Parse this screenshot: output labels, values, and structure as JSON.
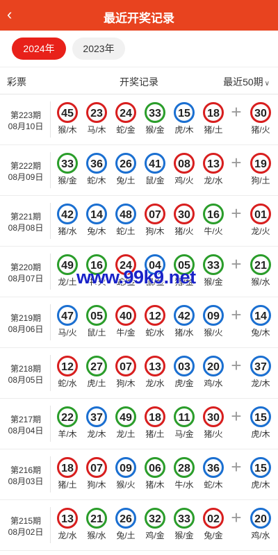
{
  "header": {
    "title": "最近开奖记录",
    "back_icon": "‹"
  },
  "tabs": [
    {
      "label": "2024年",
      "active": true
    },
    {
      "label": "2023年",
      "active": false
    }
  ],
  "columns": {
    "lottery": "彩票",
    "record": "开奖记录",
    "filter": "最近50期",
    "filter_chevron": "∨"
  },
  "plus_symbol": "+",
  "watermark": "www.99k9.net",
  "colors": {
    "red": "#d81e1e",
    "blue": "#1a6fd1",
    "green": "#2a9d2a",
    "header_bg": "#e8431f"
  },
  "draws": [
    {
      "period": "第223期",
      "date": "08月10日",
      "balls": [
        {
          "num": "45",
          "sub": "猴/木",
          "color": "red"
        },
        {
          "num": "23",
          "sub": "马/木",
          "color": "red"
        },
        {
          "num": "24",
          "sub": "蛇/金",
          "color": "red"
        },
        {
          "num": "33",
          "sub": "猴/金",
          "color": "green"
        },
        {
          "num": "15",
          "sub": "虎/木",
          "color": "blue"
        },
        {
          "num": "18",
          "sub": "猪/土",
          "color": "red"
        },
        {
          "num": "30",
          "sub": "猪/火",
          "color": "red"
        }
      ]
    },
    {
      "period": "第222期",
      "date": "08月09日",
      "balls": [
        {
          "num": "33",
          "sub": "猴/金",
          "color": "green"
        },
        {
          "num": "36",
          "sub": "蛇/木",
          "color": "blue"
        },
        {
          "num": "26",
          "sub": "兔/土",
          "color": "blue"
        },
        {
          "num": "41",
          "sub": "鼠/金",
          "color": "blue"
        },
        {
          "num": "08",
          "sub": "鸡/火",
          "color": "red"
        },
        {
          "num": "13",
          "sub": "龙/水",
          "color": "red"
        },
        {
          "num": "19",
          "sub": "狗/土",
          "color": "red"
        }
      ]
    },
    {
      "period": "第221期",
      "date": "08月08日",
      "balls": [
        {
          "num": "42",
          "sub": "猪/水",
          "color": "blue"
        },
        {
          "num": "14",
          "sub": "兔/木",
          "color": "blue"
        },
        {
          "num": "48",
          "sub": "蛇/土",
          "color": "blue"
        },
        {
          "num": "07",
          "sub": "狗/木",
          "color": "red"
        },
        {
          "num": "30",
          "sub": "猪/火",
          "color": "red"
        },
        {
          "num": "16",
          "sub": "牛/火",
          "color": "green"
        },
        {
          "num": "01",
          "sub": "龙/火",
          "color": "red"
        }
      ]
    },
    {
      "period": "第220期",
      "date": "08月07日",
      "balls": [
        {
          "num": "49",
          "sub": "龙/土",
          "color": "green"
        },
        {
          "num": "16",
          "sub": "牛/火",
          "color": "green"
        },
        {
          "num": "24",
          "sub": "蛇/金",
          "color": "red"
        },
        {
          "num": "04",
          "sub": "鼠/金",
          "color": "blue"
        },
        {
          "num": "05",
          "sub": "猪/金",
          "color": "green"
        },
        {
          "num": "33",
          "sub": "猴/金",
          "color": "green"
        },
        {
          "num": "21",
          "sub": "猴/水",
          "color": "green"
        }
      ]
    },
    {
      "period": "第219期",
      "date": "08月06日",
      "balls": [
        {
          "num": "47",
          "sub": "马/火",
          "color": "blue"
        },
        {
          "num": "05",
          "sub": "鼠/土",
          "color": "green"
        },
        {
          "num": "40",
          "sub": "牛/金",
          "color": "red"
        },
        {
          "num": "12",
          "sub": "蛇/水",
          "color": "red"
        },
        {
          "num": "42",
          "sub": "猪/水",
          "color": "blue"
        },
        {
          "num": "09",
          "sub": "猴/火",
          "color": "blue"
        },
        {
          "num": "14",
          "sub": "兔/木",
          "color": "blue"
        }
      ]
    },
    {
      "period": "第218期",
      "date": "08月05日",
      "balls": [
        {
          "num": "12",
          "sub": "蛇/水",
          "color": "red"
        },
        {
          "num": "27",
          "sub": "虎/土",
          "color": "green"
        },
        {
          "num": "07",
          "sub": "狗/木",
          "color": "red"
        },
        {
          "num": "13",
          "sub": "龙/水",
          "color": "red"
        },
        {
          "num": "03",
          "sub": "虎/金",
          "color": "blue"
        },
        {
          "num": "20",
          "sub": "鸡/水",
          "color": "blue"
        },
        {
          "num": "37",
          "sub": "龙/木",
          "color": "blue"
        }
      ]
    },
    {
      "period": "第217期",
      "date": "08月04日",
      "balls": [
        {
          "num": "22",
          "sub": "羊/木",
          "color": "green"
        },
        {
          "num": "37",
          "sub": "龙/木",
          "color": "blue"
        },
        {
          "num": "49",
          "sub": "龙/土",
          "color": "green"
        },
        {
          "num": "18",
          "sub": "猪/土",
          "color": "red"
        },
        {
          "num": "11",
          "sub": "马/金",
          "color": "green"
        },
        {
          "num": "30",
          "sub": "猪/火",
          "color": "red"
        },
        {
          "num": "15",
          "sub": "虎/木",
          "color": "blue"
        }
      ]
    },
    {
      "period": "第216期",
      "date": "08月03日",
      "balls": [
        {
          "num": "18",
          "sub": "猪/土",
          "color": "red"
        },
        {
          "num": "07",
          "sub": "狗/木",
          "color": "red"
        },
        {
          "num": "09",
          "sub": "猴/火",
          "color": "blue"
        },
        {
          "num": "06",
          "sub": "猪/木",
          "color": "green"
        },
        {
          "num": "28",
          "sub": "牛/水",
          "color": "green"
        },
        {
          "num": "36",
          "sub": "蛇/木",
          "color": "blue"
        },
        {
          "num": "15",
          "sub": "虎/木",
          "color": "blue"
        }
      ]
    },
    {
      "period": "第215期",
      "date": "08月02日",
      "balls": [
        {
          "num": "13",
          "sub": "龙/水",
          "color": "red"
        },
        {
          "num": "21",
          "sub": "猴/水",
          "color": "green"
        },
        {
          "num": "26",
          "sub": "兔/土",
          "color": "blue"
        },
        {
          "num": "32",
          "sub": "鸡/金",
          "color": "green"
        },
        {
          "num": "33",
          "sub": "猴/金",
          "color": "green"
        },
        {
          "num": "02",
          "sub": "兔/金",
          "color": "red"
        },
        {
          "num": "20",
          "sub": "鸡/水",
          "color": "blue"
        }
      ]
    }
  ]
}
